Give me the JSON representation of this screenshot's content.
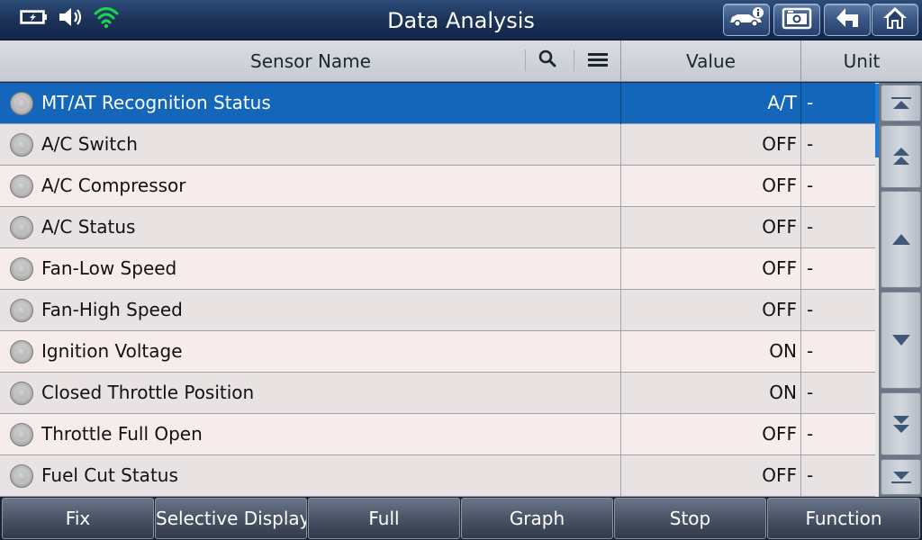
{
  "window": {
    "title": "Data Analysis"
  },
  "toolbar": {
    "buttons": [
      {
        "name": "vehicle-info-button",
        "icon": "car-info-icon"
      },
      {
        "name": "screenshot-button",
        "icon": "camera-icon"
      },
      {
        "name": "back-button",
        "icon": "return-arrow-icon"
      },
      {
        "name": "home-button",
        "icon": "home-icon"
      }
    ]
  },
  "status": {
    "icons": [
      "battery-charging-icon",
      "speaker-icon",
      "wifi-icon"
    ]
  },
  "table": {
    "columns": {
      "sensor_name": "Sensor Name",
      "value": "Value",
      "unit": "Unit"
    },
    "rows": [
      {
        "name": "MT/AT Recognition Status",
        "value": "A/T",
        "unit": "-",
        "selected": true
      },
      {
        "name": "A/C Switch",
        "value": "OFF",
        "unit": "-"
      },
      {
        "name": "A/C Compressor",
        "value": "OFF",
        "unit": "-"
      },
      {
        "name": "A/C Status",
        "value": "OFF",
        "unit": "-"
      },
      {
        "name": "Fan-Low Speed",
        "value": "OFF",
        "unit": "-"
      },
      {
        "name": "Fan-High Speed",
        "value": "OFF",
        "unit": "-"
      },
      {
        "name": "Ignition Voltage",
        "value": "ON",
        "unit": "-"
      },
      {
        "name": "Closed Throttle Position",
        "value": "ON",
        "unit": "-"
      },
      {
        "name": "Throttle Full Open",
        "value": "OFF",
        "unit": "-"
      },
      {
        "name": "Fuel Cut Status",
        "value": "OFF",
        "unit": "-"
      }
    ]
  },
  "function_bar": {
    "fix": "Fix",
    "selective_display": "Selective Display",
    "full": "Full",
    "graph": "Graph",
    "stop": "Stop",
    "function": "Function"
  },
  "colors": {
    "selected_row": "#1466bb",
    "wifi": "#19d64c",
    "title_bar": "#1c3358"
  }
}
